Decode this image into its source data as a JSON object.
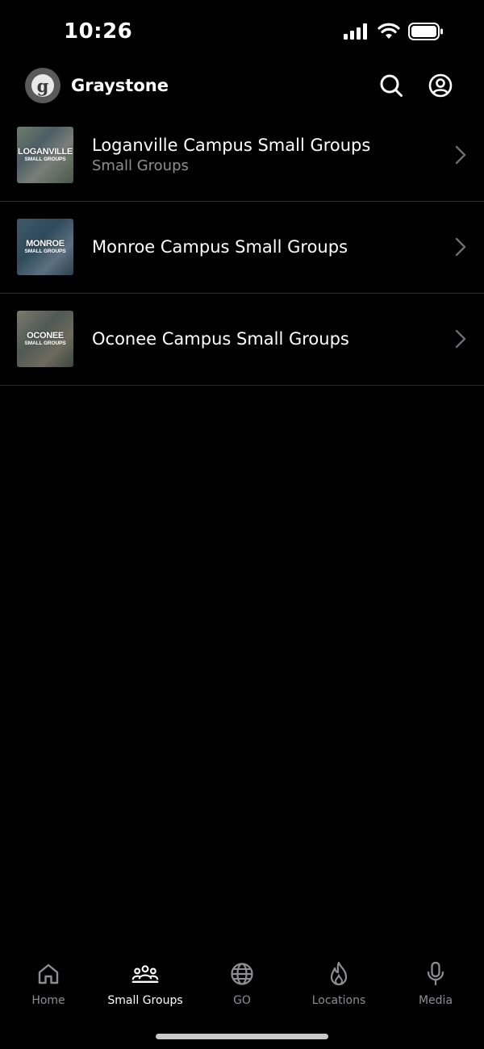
{
  "status_bar": {
    "time": "10:26"
  },
  "header": {
    "logo_letter": "g",
    "app_name": "Graystone"
  },
  "groups": [
    {
      "title": "Loganville Campus Small Groups",
      "subtitle": "Small Groups",
      "thumb_title": "LOGANVILLE",
      "thumb_subtitle": "SMALL GROUPS"
    },
    {
      "title": "Monroe Campus Small Groups",
      "subtitle": "",
      "thumb_title": "MONROE",
      "thumb_subtitle": "SMALL GROUPS"
    },
    {
      "title": "Oconee Campus Small Groups",
      "subtitle": "",
      "thumb_title": "OCONEE",
      "thumb_subtitle": "SMALL GROUPS"
    }
  ],
  "tabs": [
    {
      "label": "Home",
      "icon": "home-icon",
      "active": false
    },
    {
      "label": "Small Groups",
      "icon": "people-group-icon",
      "active": true
    },
    {
      "label": "GO",
      "icon": "globe-icon",
      "active": false
    },
    {
      "label": "Locations",
      "icon": "flame-icon",
      "active": false
    },
    {
      "label": "Media",
      "icon": "microphone-icon",
      "active": false
    }
  ],
  "colors": {
    "background": "#000000",
    "inactive_tab": "#8e8e93",
    "active_tab": "#ffffff",
    "divider": "#2b2b2b"
  }
}
